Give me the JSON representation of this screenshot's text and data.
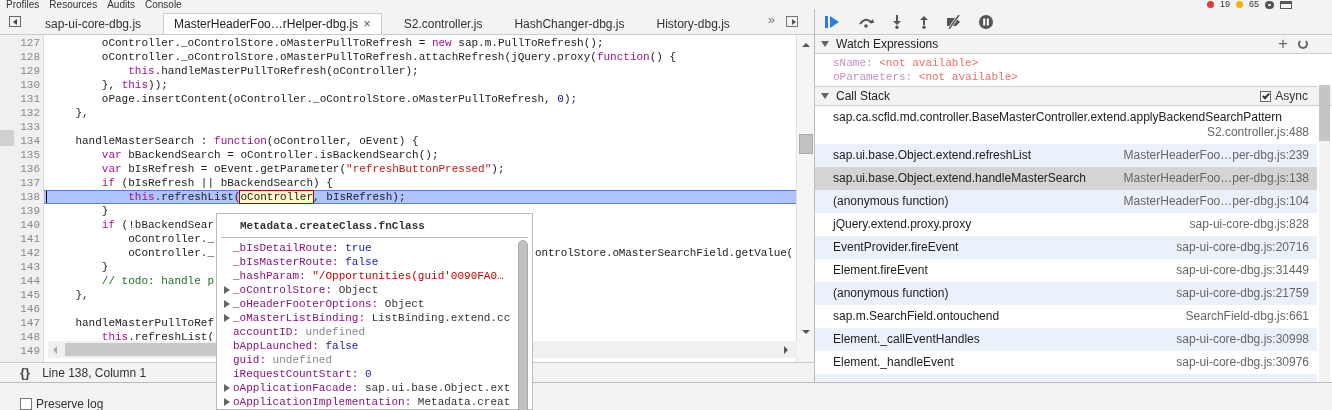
{
  "menu": [
    "Profiles",
    "Resources",
    "Audits",
    "Console"
  ],
  "counters": [
    {
      "kind": "error",
      "count": "19"
    },
    {
      "kind": "warning",
      "count": "65"
    }
  ],
  "tabs": [
    {
      "label": "sap-ui-core-dbg.js",
      "selected": false
    },
    {
      "label": "MasterHeaderFoo…rHelper-dbg.js",
      "selected": true,
      "close_label": "×"
    },
    {
      "label": "S2.controller.js",
      "selected": false
    },
    {
      "label": "HashChanger-dbg.js",
      "selected": false
    },
    {
      "label": "History-dbg.js",
      "selected": false
    }
  ],
  "more_tabs": "»",
  "editor": {
    "lines": [
      {
        "number": "127",
        "current": false,
        "tokens": [
          {
            "kind": "plain",
            "text": "        oController._oControlStore.oMasterPullToRefresh = "
          },
          {
            "kind": "keyword",
            "text": "new"
          },
          {
            "kind": "plain",
            "text": " sap.m.PullToRefresh();"
          }
        ]
      },
      {
        "number": "128",
        "current": false,
        "tokens": [
          {
            "kind": "plain",
            "text": "        oController._oControlStore.oMasterPullToRefresh.attachRefresh(jQuery.proxy("
          },
          {
            "kind": "keyword",
            "text": "function"
          },
          {
            "kind": "plain",
            "text": "() {"
          }
        ]
      },
      {
        "number": "129",
        "current": false,
        "tokens": [
          {
            "kind": "keyword",
            "text": "            this"
          },
          {
            "kind": "plain",
            "text": ".handleMasterPullToRefresh(oController);"
          }
        ]
      },
      {
        "number": "130",
        "current": false,
        "tokens": [
          {
            "kind": "plain",
            "text": "        }, "
          },
          {
            "kind": "keyword",
            "text": "this"
          },
          {
            "kind": "plain",
            "text": "));"
          }
        ]
      },
      {
        "number": "131",
        "current": false,
        "tokens": [
          {
            "kind": "plain",
            "text": "        oPage.insertContent(oController._oControlStore.oMasterPullToRefresh, "
          },
          {
            "kind": "number",
            "text": "0"
          },
          {
            "kind": "plain",
            "text": ");"
          }
        ]
      },
      {
        "number": "132",
        "current": false,
        "tokens": [
          {
            "kind": "plain",
            "text": "    },"
          }
        ]
      },
      {
        "number": "133",
        "current": false
      },
      {
        "number": "134",
        "current": false,
        "tokens": [
          {
            "kind": "plain",
            "text": "    handleMasterSearch : "
          },
          {
            "kind": "keyword",
            "text": "function"
          },
          {
            "kind": "plain",
            "text": "(oController, oEvent) {"
          }
        ]
      },
      {
        "number": "135",
        "current": false,
        "tokens": [
          {
            "kind": "keyword",
            "text": "        var"
          },
          {
            "kind": "plain",
            "text": " bBackendSearch = oController.isBackendSearch();"
          }
        ]
      },
      {
        "number": "136",
        "current": false,
        "tokens": [
          {
            "kind": "keyword",
            "text": "        var"
          },
          {
            "kind": "plain",
            "text": " bIsRefresh = oEvent.getParameter("
          },
          {
            "kind": "string",
            "text": "\"refreshButtonPressed\""
          },
          {
            "kind": "plain",
            "text": ");"
          }
        ]
      },
      {
        "number": "137",
        "current": false,
        "tokens": [
          {
            "kind": "keyword",
            "text": "        if"
          },
          {
            "kind": "plain",
            "text": " (bIsRefresh || bBackendSearch) {"
          }
        ]
      },
      {
        "number": "138",
        "current": true,
        "tokens": [
          {
            "kind": "keyword",
            "text": "            this"
          },
          {
            "kind": "plain",
            "text": ".refreshList("
          },
          {
            "kind": "hovered",
            "text": "oController"
          },
          {
            "kind": "plain",
            "text": ", bIsRefresh);"
          }
        ]
      },
      {
        "number": "139",
        "current": false,
        "tokens": [
          {
            "kind": "plain",
            "text": "        }"
          }
        ]
      },
      {
        "number": "140",
        "current": false,
        "tokens": [
          {
            "kind": "keyword",
            "text": "        if"
          },
          {
            "kind": "plain",
            "text": " (!bBackendSear"
          }
        ]
      },
      {
        "number": "141",
        "current": false,
        "tokens": [
          {
            "kind": "plain",
            "text": "            oController._"
          }
        ]
      },
      {
        "number": "142",
        "current": false,
        "tokens": [
          {
            "kind": "plain",
            "text": "            oController._"
          }
        ],
        "tail": "ontrolStore.oMasterSearchField.getValue("
      },
      {
        "number": "143",
        "current": false,
        "tokens": [
          {
            "kind": "plain",
            "text": "        }"
          }
        ]
      },
      {
        "number": "144",
        "current": false,
        "tokens": [
          {
            "kind": "comment",
            "text": "        // todo: handle p"
          }
        ]
      },
      {
        "number": "145",
        "current": false,
        "tokens": [
          {
            "kind": "plain",
            "text": "    },"
          }
        ]
      },
      {
        "number": "146",
        "current": false
      },
      {
        "number": "147",
        "current": false,
        "tokens": [
          {
            "kind": "plain",
            "text": "    handleMasterPullToRef"
          }
        ]
      },
      {
        "number": "148",
        "current": false,
        "tokens": [
          {
            "kind": "keyword",
            "text": "        this"
          },
          {
            "kind": "plain",
            "text": ".refreshList("
          }
        ]
      },
      {
        "number": "149",
        "current": false
      }
    ],
    "tooltip": {
      "title": "Metadata.createClass.fnClass",
      "properties": [
        {
          "name": "_bIsDetailRoute:",
          "value": "true",
          "kind": "boolean",
          "expandable": false
        },
        {
          "name": "_bIsMasterRoute:",
          "value": "false",
          "kind": "boolean",
          "expandable": false
        },
        {
          "name": "_hashParam:",
          "value": "\"/Opportunities(guid'0090FA0…",
          "kind": "string",
          "expandable": false
        },
        {
          "name": "_oControlStore:",
          "value": "Object",
          "kind": "object",
          "expandable": true
        },
        {
          "name": "_oHeaderFooterOptions:",
          "value": "Object",
          "kind": "object",
          "expandable": true
        },
        {
          "name": "_oMasterListBinding:",
          "value": "ListBinding.extend.cc",
          "kind": "object",
          "expandable": true
        },
        {
          "name": "accountID:",
          "value": "undefined",
          "kind": "undefined",
          "expandable": false
        },
        {
          "name": "bAppLaunched:",
          "value": "false",
          "kind": "boolean",
          "expandable": false
        },
        {
          "name": "guid:",
          "value": "undefined",
          "kind": "undefined",
          "expandable": false
        },
        {
          "name": "iRequestCountStart:",
          "value": "0",
          "kind": "number",
          "expandable": false
        },
        {
          "name": "oApplicationFacade:",
          "value": "sap.ui.base.Object.ext",
          "kind": "object",
          "expandable": true
        },
        {
          "name": "oApplicationImplementation:",
          "value": "Metadata.creat",
          "kind": "object",
          "expandable": true
        }
      ]
    }
  },
  "status_bar": {
    "pretty_print": "{}",
    "position": "Line 138, Column 1"
  },
  "console_drawer": {
    "preserve_log": {
      "label": "Preserve log",
      "checked": false
    }
  },
  "debugger": {
    "watch": {
      "title": "Watch Expressions",
      "expanded": true,
      "add_label": "+",
      "items": [
        {
          "name": "sName:",
          "value": "<not available>"
        },
        {
          "name": "oParameters:",
          "value": "<not available>"
        }
      ]
    },
    "call_stack": {
      "title": "Call Stack",
      "expanded": true,
      "async": {
        "label": "Async",
        "checked": true
      },
      "frames": [
        {
          "name": "sap.ca.scfld.md.controller.BaseMasterController.extend.applyBackendSearchPattern",
          "location": "S2.controller.js:488",
          "selected": false
        },
        {
          "name": "sap.ui.base.Object.extend.refreshList",
          "location": "MasterHeaderFoo…per-dbg.js:239",
          "selected": false
        },
        {
          "name": "sap.ui.base.Object.extend.handleMasterSearch",
          "location": "MasterHeaderFoo…per-dbg.js:138",
          "selected": true
        },
        {
          "name": "(anonymous function)",
          "location": "MasterHeaderFoo…per-dbg.js:104",
          "selected": false
        },
        {
          "name": "jQuery.extend.proxy.proxy",
          "location": "sap-ui-core-dbg.js:828",
          "selected": false
        },
        {
          "name": "EventProvider.fireEvent",
          "location": "sap-ui-core-dbg.js:20716",
          "selected": false
        },
        {
          "name": "Element.fireEvent",
          "location": "sap-ui-core-dbg.js:31449",
          "selected": false
        },
        {
          "name": "(anonymous function)",
          "location": "sap-ui-core-dbg.js:21759",
          "selected": false
        },
        {
          "name": "sap.m.SearchField.ontouchend",
          "location": "SearchField-dbg.js:661",
          "selected": false
        },
        {
          "name": "Element._callEventHandles",
          "location": "sap-ui-core-dbg.js:30998",
          "selected": false
        },
        {
          "name": "Element._handleEvent",
          "location": "sap-ui-core-dbg.js:30976",
          "selected": false
        }
      ]
    }
  }
}
